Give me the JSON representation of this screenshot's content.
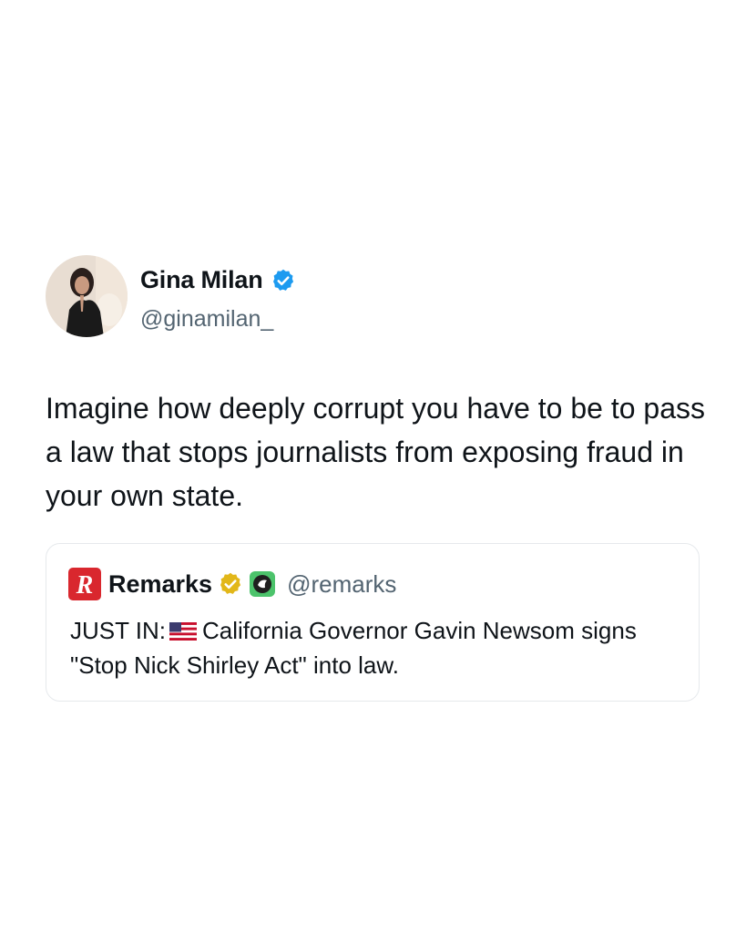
{
  "author": {
    "display_name": "Gina Milan",
    "handle": "@ginamilan_",
    "verified_icon": "blue-verified-badge"
  },
  "tweet": {
    "text": "Imagine how deeply corrupt you have to be to pass a law that stops journalists from exposing fraud in your own state."
  },
  "quoted_tweet": {
    "logo_letter": "R",
    "display_name": "Remarks",
    "handle": "@remarks",
    "verified_icon": "gold-verified-badge",
    "affiliate_icon": "affiliate-badge",
    "text_prefix": "JUST IN:",
    "flag_icon": "us-flag-icon",
    "text_rest": "California Governor Gavin Newsom signs \"Stop Nick Shirley Act\" into law."
  },
  "colors": {
    "verified_blue": "#1d9bf0",
    "remarks_red": "#d9272e",
    "gold_badge": "#e2b719",
    "handle_gray": "#536471"
  }
}
